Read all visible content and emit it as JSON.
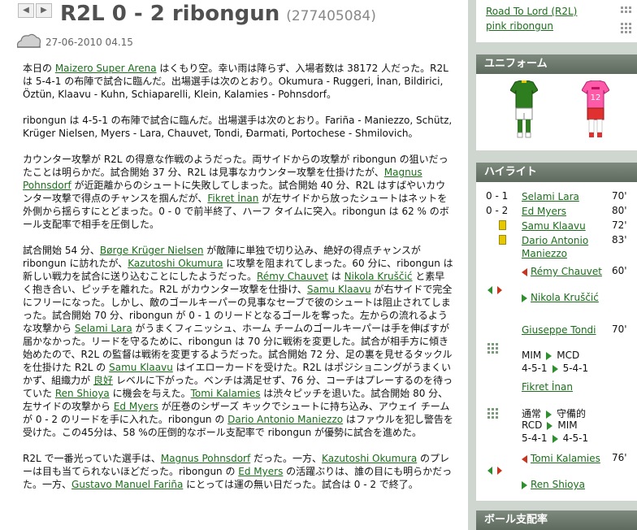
{
  "header": {
    "title": "R2L 0 - 2 ribongun",
    "match_id": "(277405084)",
    "date": "27-06-2010 04.15"
  },
  "article": {
    "p1": {
      "t1": "本日の ",
      "l1": "Maizero Super Arena",
      "t2": " はくもり空。幸い雨は降らず、入場者数は 38172 人だった。R2L は 5-4-1 の布陣で試合に臨んだ。出場選手は次のとおり。Okumura - Ruggeri, İnan, Bildirici, Öztün, Klaavu - Kuhn, Schiaparelli, Klein, Kalamies - Pohnsdorf。"
    },
    "p2": {
      "t1": "ribongun は 4-5-1 の布陣で試合に臨んだ。出場選手は次のとおり。Fariña - Maniezzo, Schütz, Krüger Nielsen, Myers - Lara, Chauvet, Tondi, Đarmati, Portochese - Shmilovich。"
    },
    "p3": {
      "t1": "カウンター攻撃が R2L の得意な作戦のようだった。両サイドからの攻撃が ribongun の狙いだったことは明らかだ。試合開始 37 分、R2L は見事なカウンター攻撃を仕掛けたが、",
      "l1": "Magnus Pohnsdorf",
      "t2": " が近距離からのシュートに失敗してしまった。試合開始 40 分、R2L はすばやいカウンター攻撃で得点のチャンスを掴んだが、",
      "l2": "Fikret İnan",
      "t3": " が左サイドから放ったシュートはネットを外側から揺らすにとどまった。0 - 0 で前半終了、ハーフ タイムに突入。ribongun は 62 % のボール支配率で相手を圧倒した。"
    },
    "p4": {
      "t1": "試合開始 54 分、",
      "l1": "Børge Krüger Nielsen",
      "t2": " が敵陣に単独で切り込み、絶好の得点チャンスが ribongun に訪れたが、",
      "l2": "Kazutoshi Okumura",
      "t3": " に攻撃を阻まれてしまった。60 分に、ribongun は新しい戦力を試合に送り込むことにしたようだった。",
      "l3": "Rémy Chauvet",
      "t4": " は ",
      "l4": "Nikola Kruščić",
      "t5": " と素早く抱き合い、ピッチを離れた。R2L がカウンター攻撃を仕掛け、",
      "l5": "Samu Klaavu",
      "t6": " が右サイドで完全にフリーになった。しかし、敵のゴールキーパーの見事なセーブで彼のシュートは阻止されてしまった。試合開始 70 分、ribongun が 0 - 1 のリードとなるゴールを奪った。左からの流れるような攻撃から ",
      "l6": "Selami Lara",
      "t7": " がうまくフィニッシュ、ホーム チームのゴールキーパーは手を伸ばすが届かなかった。リードを守るために、ribongun は 70 分に戦術を変更した。試合が相手方に傾き始めたので、R2L の監督は戦術を変更するようだった。試合開始 72 分、足の裏を見せるタックルを仕掛けた R2L の ",
      "l7": "Samu Klaavu",
      "t8": " はイエローカードを受けた。R2L はポジショニングがうまくいかず、組織力が ",
      "l8": "良好",
      "t9": " レベルに下がった。ベンチは満足せず、76 分、コーチはプレーするのを待っていた ",
      "l9": "Ren Shioya",
      "t10": " に機会を与えた。",
      "l10": "Tomi Kalamies",
      "t11": " は渋々ピッチを退いた。試合開始 80 分、左サイドの攻撃から ",
      "l11": "Ed Myers",
      "t12": " が圧巻のシザーズ キックでシュートに持ち込み、アウェイ チームが 0 - 2 のリードを手に入れた。ribongun の ",
      "l12": "Dario Antonio Maniezzo",
      "t13": " はファウルを犯し警告を受けた。この45分は、58 %の圧倒的なボール支配率で ribongun が優勢に試合を進めた。"
    },
    "p5": {
      "t1": "R2L で一番光っていた選手は、",
      "l1": "Magnus Pohnsdorf",
      "t2": " だった。一方、",
      "l2": "Kazutoshi Okumura",
      "t3": " のプレーは目も当てられないほどだった。ribongun の ",
      "l3": "Ed Myers",
      "t4": " の活躍ぶりは、誰の目にも明らかだった。一方、",
      "l4": "Gustavo Manuel Fariña",
      "t5": " にとっては運の無い日だった。試合は 0 - 2 で終了。"
    }
  },
  "sidebar": {
    "top_links": [
      "Road To Lord (R2L)",
      "pink ribongun"
    ],
    "uniform": {
      "title": "ユニフォーム",
      "home_number": "",
      "away_number": "12",
      "colors": {
        "home_shirt": "#2e7d1e",
        "home_trim": "#e6c800",
        "away_shirt": "#ff5aa8",
        "away_shorts": "#e03030"
      }
    },
    "highlights": {
      "title": "ハイライト",
      "goals": [
        {
          "score": "0 - 1",
          "player": "Selami Lara",
          "minute": "70'"
        },
        {
          "score": "0 - 2",
          "player": "Ed Myers",
          "minute": "80'"
        }
      ],
      "cards": [
        {
          "player": "Samu Klaavu",
          "minute": "72'"
        },
        {
          "player": "Dario Antonio Maniezzo",
          "minute": "83'"
        }
      ],
      "sub1": {
        "out": "Rémy Chauvet",
        "in": "Nikola Kruščić",
        "minute": "60'"
      },
      "tactic1": {
        "player": "Giuseppe Tondi",
        "minute": "70'",
        "from1": "MIM",
        "to1": "MCD",
        "from2": "4-5-1",
        "to2": "5-4-1"
      },
      "tactic2": {
        "player": "Fikret İnan",
        "minute": "",
        "from1": "通常",
        "to1": "守備的",
        "from2": "RCD",
        "to2": "MIM",
        "from3": "5-4-1",
        "to3": "4-5-1"
      },
      "sub2": {
        "out": "Tomi Kalamies",
        "in": "Ren Shioya",
        "minute": "76'"
      }
    },
    "possession": {
      "title": "ボール支配率"
    }
  }
}
